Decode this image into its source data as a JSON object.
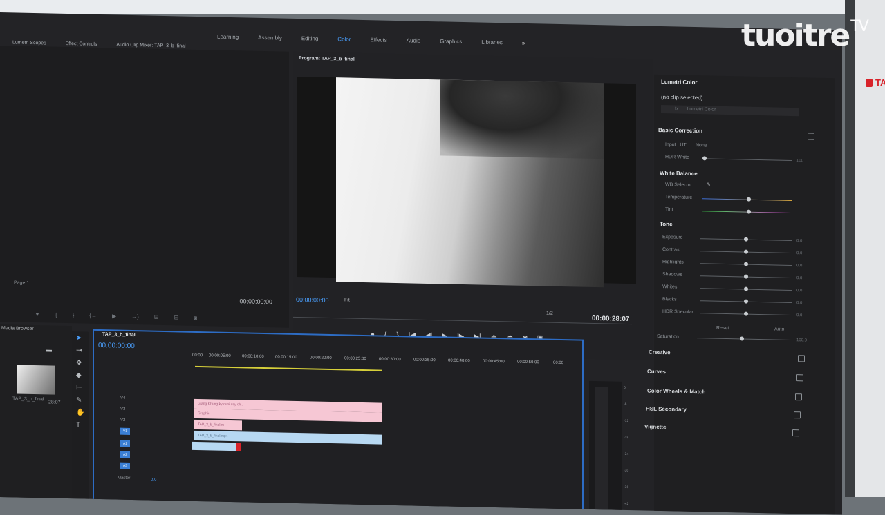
{
  "workspaces": {
    "items": [
      "Learning",
      "Assembly",
      "Editing",
      "Color",
      "Effects",
      "Audio",
      "Graphics",
      "Libraries"
    ],
    "active": "Color",
    "more": "»"
  },
  "source_panel": {
    "tabs": [
      "Lumetri Scopes",
      "Effect Controls",
      "Audio Clip Mixer: TAP_3_b_final"
    ],
    "timecode": "00;00;00;00",
    "page_label": "Page 1"
  },
  "program": {
    "title": "Program: TAP_3_b_final",
    "timecode": "00:00:00:00",
    "fit": "Fit",
    "resolution": "1/2",
    "duration": "00:00:28:07"
  },
  "lumetri": {
    "title": "Lumetri Color",
    "subtitle": "(no clip selected)",
    "fx_label": "fx",
    "fx_placeholder": "Lumetri Color",
    "basic_correction": "Basic Correction",
    "input_lut": "Input LUT",
    "input_lut_value": "None",
    "hdr_white": "HDR White",
    "hdr_white_value": "100",
    "white_balance": "White Balance",
    "wb_selector": "WB Selector",
    "temperature": "Temperature",
    "tint": "Tint",
    "tone": "Tone",
    "tone_rows": [
      {
        "label": "Exposure",
        "value": "0.0"
      },
      {
        "label": "Contrast",
        "value": "0.0"
      },
      {
        "label": "Highlights",
        "value": "0.0"
      },
      {
        "label": "Shadows",
        "value": "0.0"
      },
      {
        "label": "Whites",
        "value": "0.0"
      },
      {
        "label": "Blacks",
        "value": "0.0"
      },
      {
        "label": "HDR Specular",
        "value": "0.0"
      }
    ],
    "reset": "Reset",
    "auto": "Auto",
    "saturation": "Saturation",
    "saturation_value": "100.0",
    "sections": [
      "Creative",
      "Curves",
      "Color Wheels & Match",
      "HSL Secondary",
      "Vignette"
    ]
  },
  "project": {
    "title": "Media Browser",
    "clip_name": "TAP_3_b_final",
    "clip_dur": "28:07"
  },
  "timeline": {
    "title": "TAP_3_b_final",
    "timecode": "00:00:00:00",
    "ruler": [
      "00:00",
      "00:00:05:00",
      "00:00:10:00",
      "00:00:15:00",
      "00:00:20:00",
      "00:00:25:00",
      "00:00:30:00",
      "00:00:35:00",
      "00:00:40:00",
      "00:00:45:00",
      "00:00:50:00",
      "00:00"
    ],
    "video_tracks": [
      "V4",
      "V3",
      "V2",
      "V1"
    ],
    "audio_tracks": [
      "A1",
      "A2",
      "A3"
    ],
    "clip_v3": "Giang Khung ky duoi cay ch...",
    "clip_v2": "Graphic",
    "clip_v1": "TAP_3_b_final.m",
    "clip_a1": "TAP_3_b_final.mp4",
    "master": "Master",
    "master_value": "0.0"
  },
  "meter": {
    "scale": [
      "0",
      "-6",
      "-12",
      "-18",
      "-24",
      "-30",
      "-36",
      "-42"
    ]
  },
  "branding": {
    "watermark": "tuoitre",
    "tv": "TV",
    "side_text": "TA"
  }
}
